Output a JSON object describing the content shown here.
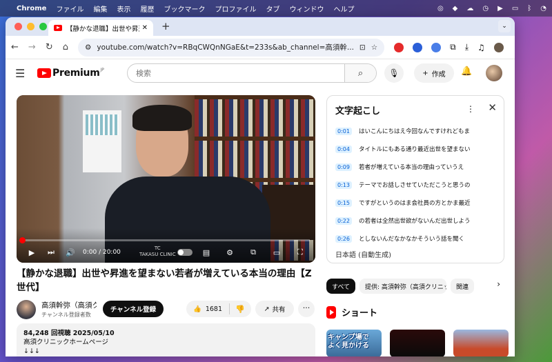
{
  "menubar": {
    "app": "Chrome",
    "items": [
      "ファイル",
      "編集",
      "表示",
      "履歴",
      "ブックマーク",
      "プロファイル",
      "タブ",
      "ウィンドウ",
      "ヘルプ"
    ]
  },
  "browser": {
    "tab_title": "【静かな退職】出世や昇進を望ま",
    "url": "youtube.com/watch?v=RBqCWQnNGaE&t=233s&ab_channel=高須幹..."
  },
  "youtube": {
    "logo_text": "Premium",
    "logo_region": "JP",
    "search_placeholder": "検索",
    "create_label": "作成"
  },
  "player": {
    "time_current": "0:00",
    "time_total": "20:00",
    "time_display": "0:00 / 20:00",
    "progress": 0.0,
    "watermark_logo": "TC",
    "watermark_text": "TAKASU CLINIC"
  },
  "video": {
    "title": "【静かな退職】出世や昇進を望まない若者が増えている本当の理由【Z世代】",
    "channel_name": "高須幹弥（高須クリニック）",
    "channel_subs": "チャンネル登録者数",
    "subscribe_label": "チャンネル登録",
    "likes": "1681",
    "share_label": "共有",
    "views_date": "84,248 回視聴  2025/05/10",
    "desc_line1": "高須クリニックホームページ",
    "desc_line2": "↓↓↓"
  },
  "transcript": {
    "title": "文字起こし",
    "lines": [
      {
        "time": "0:01",
        "text": "はいこんにちはえ今回なんですけれどもま"
      },
      {
        "time": "0:04",
        "text": "タイトルにもある通り最近出世を望まない"
      },
      {
        "time": "0:09",
        "text": "若者が増えている本当の理由っていうえ"
      },
      {
        "time": "0:13",
        "text": "テーマでお話しさせていただこうと思うの"
      },
      {
        "time": "0:15",
        "text": "ですがというのはま会社員の方とかま最近"
      },
      {
        "time": "0:22",
        "text": "の若者は全然出世欲がないんだ出世しよう"
      },
      {
        "time": "0:26",
        "text": "としないんだなかなかそういう話を聞く"
      }
    ],
    "language": "日本語 (自動生成)"
  },
  "chips": [
    "すべて",
    "提供: 高須幹弥（高須クリニック）",
    "関連"
  ],
  "shorts": {
    "title": "ショート",
    "thumb1_text_l1": "キャンプ場で",
    "thumb1_text_l2": "よく見かける"
  },
  "colors": {
    "accent": "#ff0000",
    "link": "#065fd4"
  }
}
